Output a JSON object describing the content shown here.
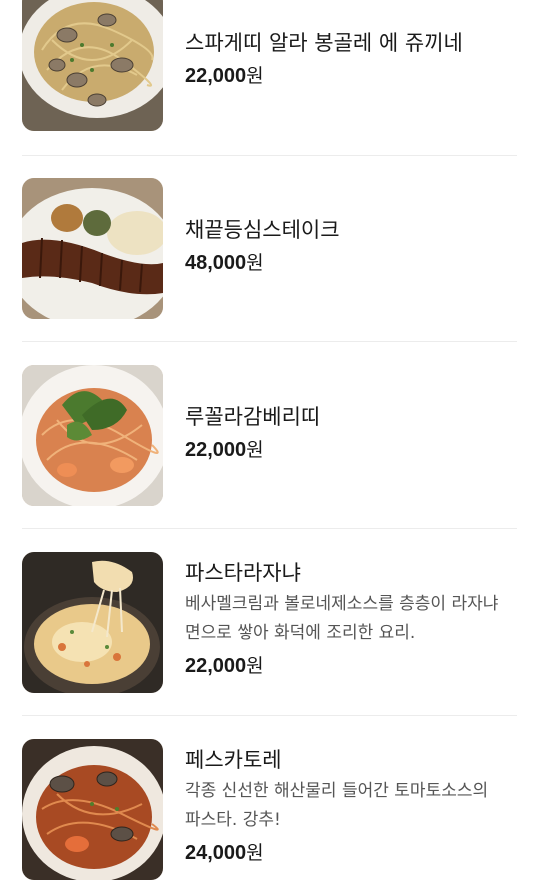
{
  "menu": {
    "items": [
      {
        "name": "스파게띠 알라 봉골레 에 쥬끼네",
        "description": "",
        "price_num": "22,000",
        "currency": "원",
        "photo": "clam-pasta-photo"
      },
      {
        "name": "채끝등심스테이크",
        "description": "",
        "price_num": "48,000",
        "currency": "원",
        "photo": "steak-photo"
      },
      {
        "name": "루꼴라감베리띠",
        "description": "",
        "price_num": "22,000",
        "currency": "원",
        "photo": "arugula-shrimp-pasta-photo"
      },
      {
        "name": "파스타라자냐",
        "description": "베사멜크림과 볼로네제소스를 층층이 라자냐 면으로 쌓아 화덕에 조리한 요리.",
        "price_num": "22,000",
        "currency": "원",
        "photo": "lasagna-photo"
      },
      {
        "name": "페스카토레",
        "description": "각종 신선한 해산물리 들어간 토마토소스의 파스타. 강추!",
        "price_num": "24,000",
        "currency": "원",
        "photo": "seafood-tomato-pasta-photo"
      }
    ]
  }
}
